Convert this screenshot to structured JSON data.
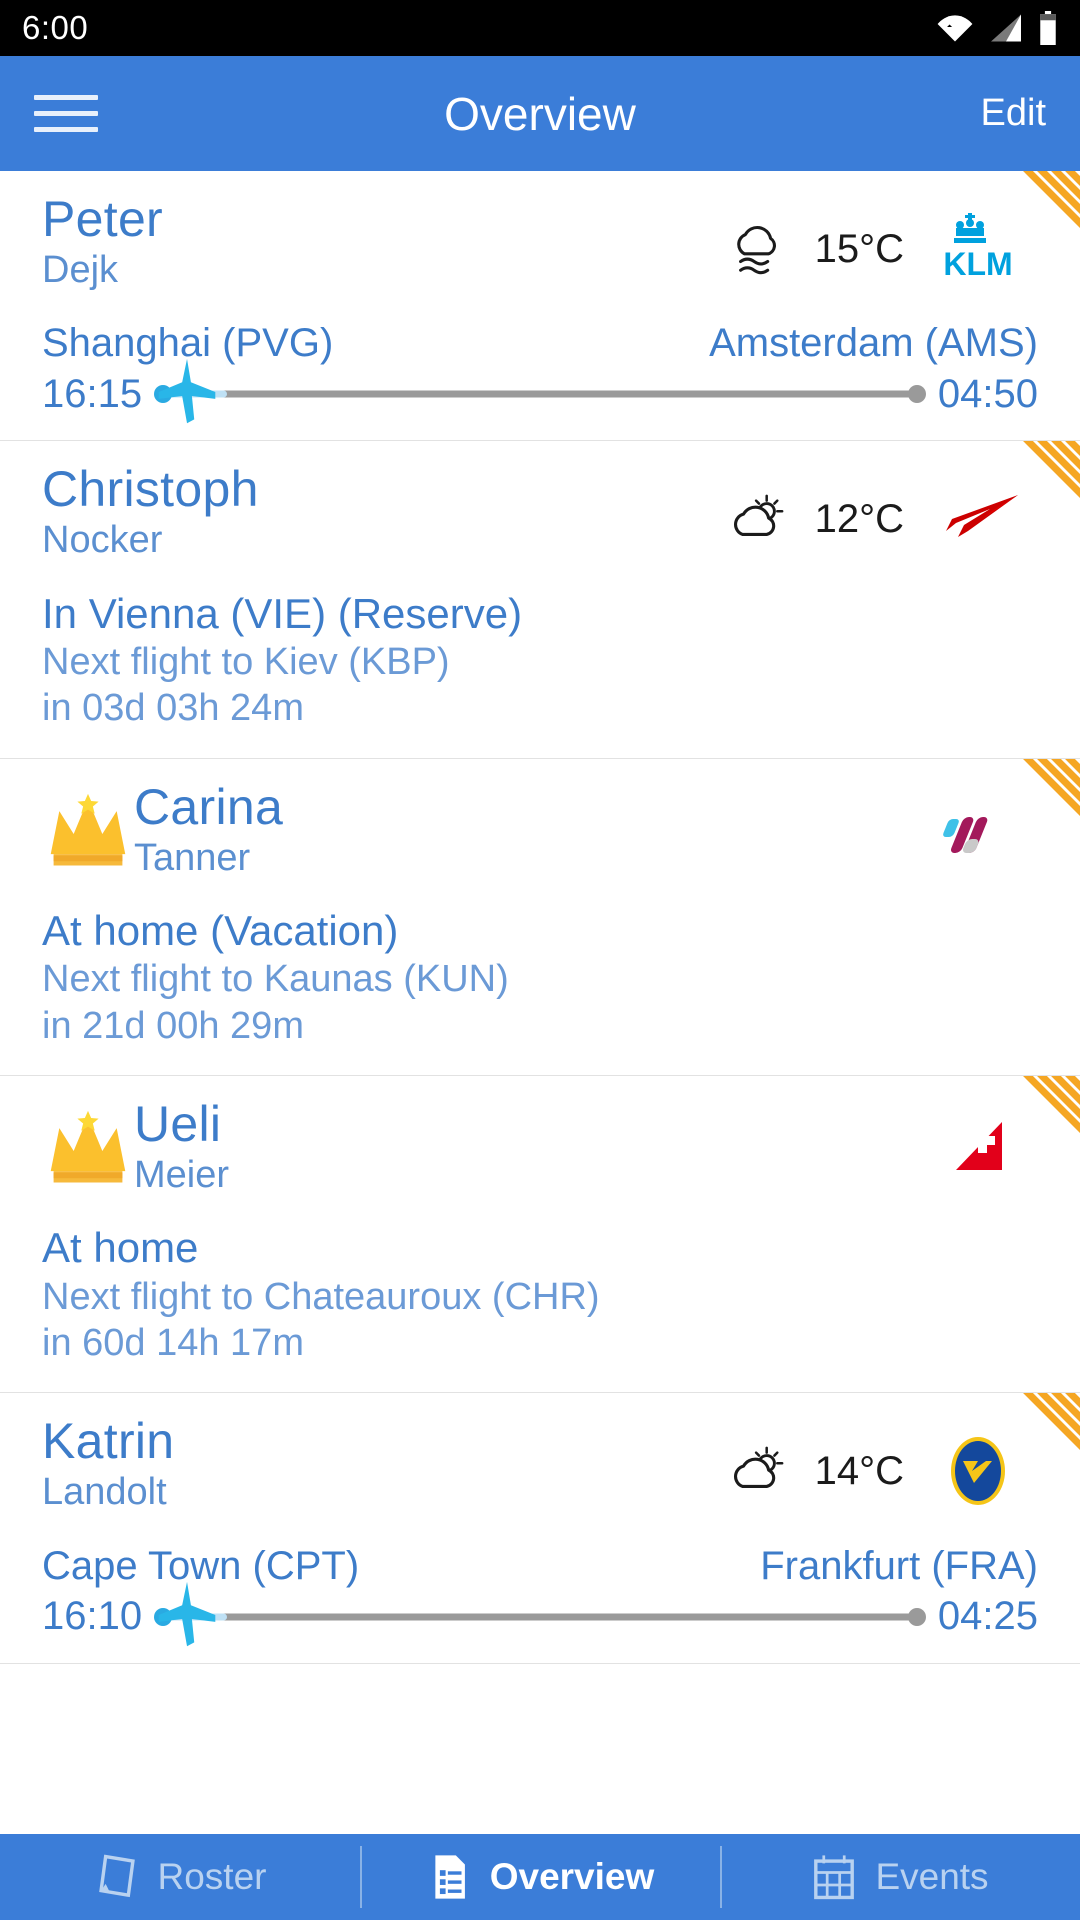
{
  "status_bar": {
    "time": "6:00",
    "icons": [
      "wifi-icon",
      "cellular-signal-icon",
      "battery-icon"
    ]
  },
  "app_bar": {
    "menu_icon": "hamburger-menu-icon",
    "title": "Overview",
    "action_label": "Edit"
  },
  "colors": {
    "accent_blue": "#3b7dd8",
    "link_blue": "#3d7cc9",
    "muted_blue": "#6b9ad6",
    "stripe_orange": "#f5a623",
    "plane_cyan": "#29b6e8",
    "line_gray": "#9a9a9a"
  },
  "crew": [
    {
      "first_name": "Peter",
      "last_name": "Dejk",
      "has_crown": false,
      "weather_icon": "fog-icon",
      "temperature": "15°C",
      "airline_logo": "klm-logo",
      "has_stripes": true,
      "flight": {
        "origin": "Shanghai (PVG)",
        "destination": "Amsterdam (AMS)",
        "departure_time": "16:15",
        "arrival_time": "04:50",
        "progress_percent": 9
      }
    },
    {
      "first_name": "Christoph",
      "last_name": "Nocker",
      "has_crown": false,
      "weather_icon": "partly-cloudy-icon",
      "temperature": "12°C",
      "airline_logo": "austrian-airlines-logo",
      "has_stripes": true,
      "status": {
        "main": "In Vienna (VIE) (Reserve)",
        "next_flight": "Next flight to Kiev (KBP)",
        "countdown": "in 03d 03h 24m"
      }
    },
    {
      "first_name": "Carina",
      "last_name": "Tanner",
      "has_crown": true,
      "weather_icon": null,
      "temperature": null,
      "airline_logo": "eurowings-logo",
      "has_stripes": true,
      "status": {
        "main": "At home (Vacation)",
        "next_flight": "Next flight to Kaunas (KUN)",
        "countdown": "in 21d 00h 29m"
      }
    },
    {
      "first_name": "Ueli",
      "last_name": "Meier",
      "has_crown": true,
      "weather_icon": null,
      "temperature": null,
      "airline_logo": "swiss-logo",
      "has_stripes": true,
      "status": {
        "main": "At home",
        "next_flight": "Next flight to Chateauroux (CHR)",
        "countdown": "in 60d 14h 17m"
      }
    },
    {
      "first_name": "Katrin",
      "last_name": "Landolt",
      "has_crown": false,
      "weather_icon": "partly-cloudy-icon",
      "temperature": "14°C",
      "airline_logo": "condor-logo",
      "has_stripes": true,
      "flight": {
        "origin": "Cape Town (CPT)",
        "destination": "Frankfurt (FRA)",
        "departure_time": "16:10",
        "arrival_time": "04:25",
        "progress_percent": 9
      }
    }
  ],
  "bottom_nav": {
    "items": [
      {
        "label": "Roster",
        "icon": "roster-icon",
        "active": false
      },
      {
        "label": "Overview",
        "icon": "document-icon",
        "active": true
      },
      {
        "label": "Events",
        "icon": "calendar-icon",
        "active": false
      }
    ]
  }
}
